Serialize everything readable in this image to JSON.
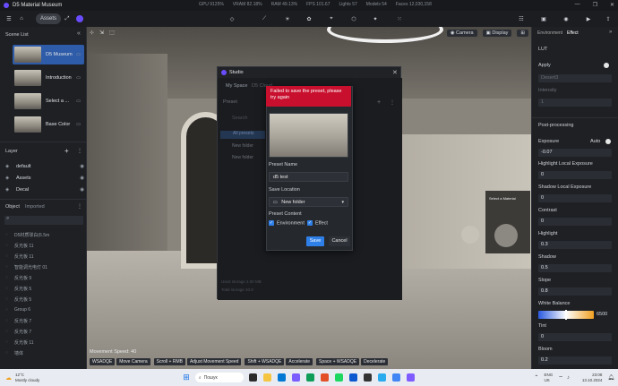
{
  "titlebar": {
    "app_title": "D5 Material Museum",
    "stats": [
      "GPU 9125%",
      "VRAM 82.18%",
      "RAM 49.13%",
      "FPS 101.67",
      "Lights 57",
      "Models 54",
      "Faces 12,030,158"
    ],
    "win_controls": [
      "—",
      "❐",
      "✕"
    ]
  },
  "toolbar": {
    "assets_label": "Assets"
  },
  "left": {
    "scene_list_title": "Scene List",
    "scenes": [
      {
        "label": "D5 Museum"
      },
      {
        "label": "Introduction"
      },
      {
        "label": "Select a ..."
      },
      {
        "label": "Base Color"
      }
    ],
    "layer_title": "Layer",
    "layers": [
      {
        "label": "default"
      },
      {
        "label": "Assets"
      },
      {
        "label": "Decal"
      }
    ],
    "tabs": {
      "object": "Object",
      "imported": "Imported"
    },
    "objects": [
      "D5材质球白(6.5m",
      "反光板 11",
      "反光板 11",
      "智能调光电灯 01",
      "反光板 9",
      "反光板 5",
      "反光板 5",
      "Group 6",
      "反光板 7",
      "反光板 7",
      "反光板 11",
      "墙体"
    ]
  },
  "viewport": {
    "camera_label": "Camera",
    "display_label": "Display",
    "speed": "Movement Speed: 40",
    "hints": [
      {
        "key": "WSADQE",
        "action": "Move Camera"
      },
      {
        "key": "Scroll + RMB",
        "action": "Adjust Movement Speed"
      },
      {
        "key": "Shift + WSADQE",
        "action": "Accelerate"
      },
      {
        "key": "Space + WSADQE",
        "action": "Decelerate"
      }
    ],
    "wall_sign": "Select a Material"
  },
  "studio": {
    "title": "Studio",
    "tabs": [
      "My Space",
      "D5 Cloud"
    ],
    "preset_label": "Preset",
    "search": "Search",
    "tree": [
      "All presets",
      "New folder",
      "New folder"
    ],
    "footer_lines": [
      "Used storage 2.00 MB",
      "Total storage 10.0"
    ]
  },
  "preset_dialog": {
    "error": "Failed to save the preset, please try again",
    "name_label": "Preset Name",
    "name_value": "d5 test",
    "location_label": "Save Location",
    "location_value": "New folder",
    "content_label": "Preset Content",
    "check_env": "Environment",
    "check_effect": "Effect",
    "save_label": "Save",
    "cancel_label": "Cancel"
  },
  "right": {
    "tabs": [
      "Environment",
      "Effect"
    ],
    "lut_title": "LUT",
    "apply_label": "Apply",
    "lut_preset": "Desert3",
    "intensity_label": "Intensity",
    "intensity_value": "1",
    "post_title": "Post-processing",
    "exposure_label": "Exposure",
    "exposure_auto": "Auto",
    "exposure_value": "-0.07",
    "params": [
      {
        "label": "Highlight Local Exposure",
        "value": "0"
      },
      {
        "label": "Shadow Local Exposure",
        "value": "0"
      },
      {
        "label": "Contrast",
        "value": "0"
      },
      {
        "label": "Highlight",
        "value": "0.3"
      },
      {
        "label": "Shadow",
        "value": "0.5"
      },
      {
        "label": "Slope",
        "value": "0.8"
      }
    ],
    "wb_label": "White Balance",
    "wb_value": "6500",
    "tint_label": "Tint",
    "tint_value": "0",
    "bloom_label": "Bloom",
    "bloom_value": "0.2"
  },
  "taskbar": {
    "weather_temp": "12°C",
    "weather_desc": "Mostly cloudy",
    "search_placeholder": "Пошук",
    "lang": "ENG",
    "lang2": "US",
    "time": "23:08",
    "date": "13.10.2024"
  },
  "colors": {
    "accent": "#2f7fe8",
    "error": "#c8102e",
    "brand": "#6a4cff"
  }
}
